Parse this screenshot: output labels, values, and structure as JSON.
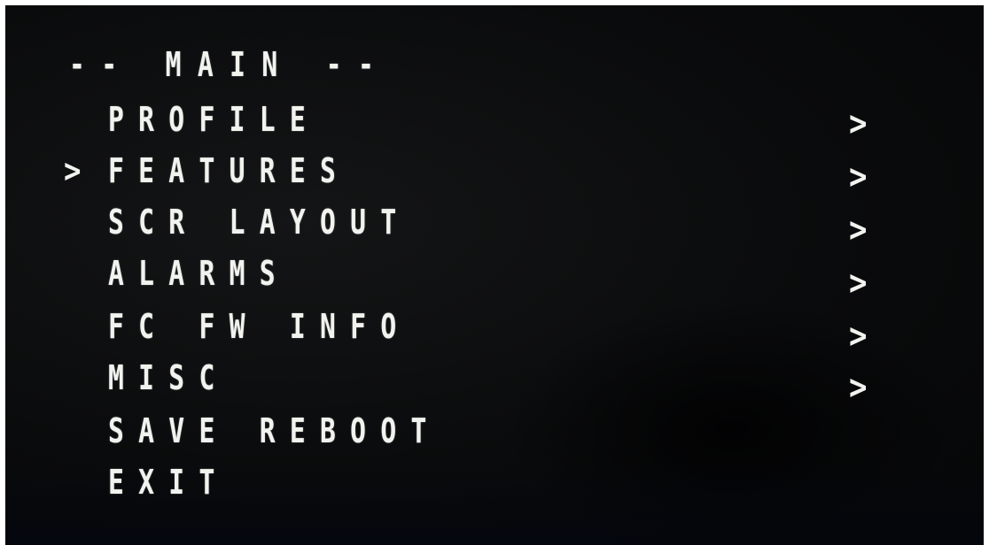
{
  "menu": {
    "title": "-- MAIN --",
    "cursor": ">",
    "items": [
      {
        "label": "PROFILE",
        "arrow": ">"
      },
      {
        "label": "FEATURES",
        "arrow": ">",
        "selected": true
      },
      {
        "label": "SCR LAYOUT",
        "arrow": ">"
      },
      {
        "label": "ALARMS",
        "arrow": ">"
      },
      {
        "label": "FC FW INFO",
        "arrow": ">"
      },
      {
        "label": "MISC",
        "arrow": ">"
      },
      {
        "label": "SAVE REBOOT"
      },
      {
        "label": "EXIT"
      }
    ]
  }
}
